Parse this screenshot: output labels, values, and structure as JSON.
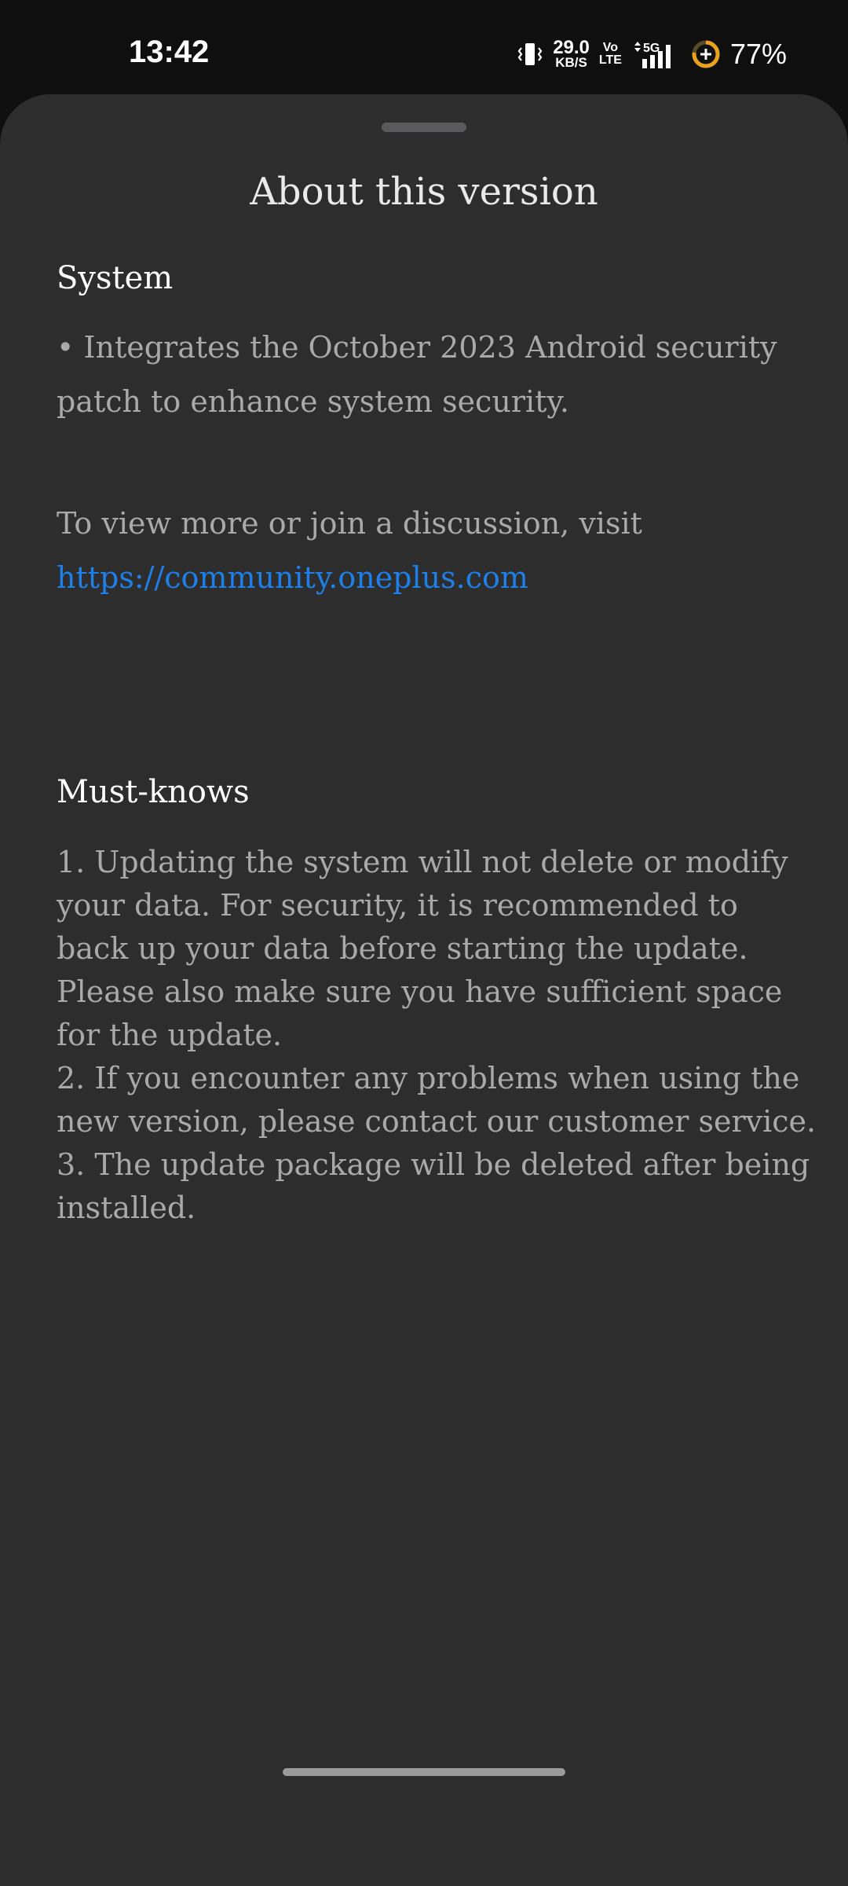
{
  "status_bar": {
    "time": "13:42",
    "net_speed_value": "29.0",
    "net_speed_unit": "KB/S",
    "volte_top": "Vo",
    "volte_bottom": "LTE",
    "network": "5G",
    "battery": "77%",
    "icons": [
      "vibrate-icon",
      "signal-icon",
      "battery-icon"
    ]
  },
  "sheet": {
    "title": "About this version",
    "system": {
      "heading": "System",
      "bullet": "• Integrates the October 2023 Android security patch to enhance system security."
    },
    "community": {
      "text": "To view more or join a discussion, visit",
      "link": "https://community.oneplus.com"
    },
    "must_knows": {
      "heading": "Must-knows",
      "items": [
        "1. Updating the system will not delete or modify your data. For security, it is recommended to back up your data before starting the update. Please also make sure you have sufficient space for the update.",
        "2. If you encounter any problems when using the new version, please contact our customer service.",
        "3. The update package will be deleted after being installed."
      ]
    }
  },
  "colors": {
    "sheet_bg": "#2d2d2e",
    "status_bg": "#0f0f10",
    "link": "#1e7fe8",
    "body_text": "#a9a9a9",
    "battery_ring": "#e8a21b"
  }
}
